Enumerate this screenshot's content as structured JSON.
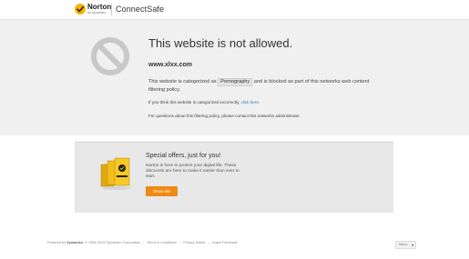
{
  "header": {
    "logo_text": "Norton",
    "logo_sub": "by Symantec",
    "product": "ConnectSafe"
  },
  "block": {
    "title": "This website is not allowed.",
    "domain": "www.xlxx.com",
    "category_prefix": "This website is categorized as",
    "category": "Pornography",
    "category_suffix": "and is blocked as part of this networks web content filtering policy.",
    "incorrect_prefix": "If you think this website is categorized incorrectly,",
    "incorrect_link": "click here.",
    "admin_line": "For questions about this filtering policy, please contact this networks administrator."
  },
  "offers": {
    "title": "Special offers, just for you!",
    "body": "Norton is here to protect your digital life. These discounts are here to make it easier than ever to start.",
    "button": "Show Me"
  },
  "footer": {
    "powered_by": "Powered by",
    "symantec": "Symantec.",
    "copyright": "© 1995-2013 Symantec Corporation",
    "links": [
      "Terms & Conditions",
      "Privacy Notice",
      "Leave Feedback"
    ],
    "language": "Menu"
  },
  "colors": {
    "accent": "#ef8a14",
    "link": "#2a7ac4",
    "band": "#f0f0f0"
  }
}
